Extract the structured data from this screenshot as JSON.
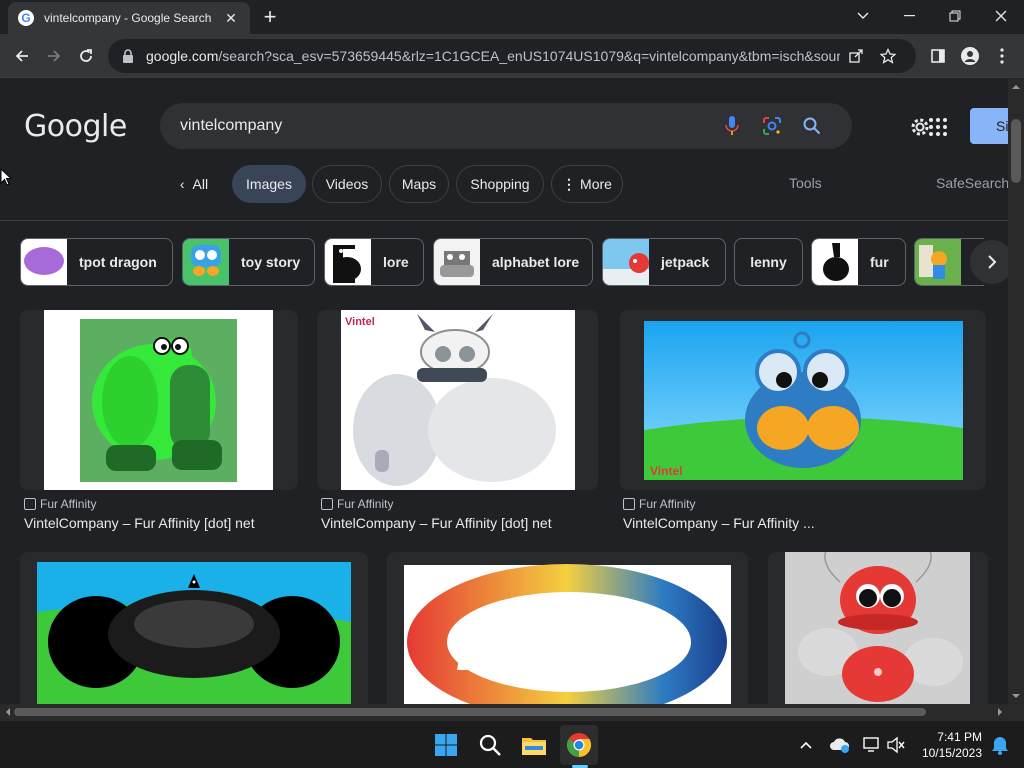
{
  "browser": {
    "tab_title": "vintelcompany - Google Search",
    "url_domain": "google.com",
    "url_path": "/search?sca_esv=573659445&rlz=1C1GCEA_enUS1074US1079&q=vintelcompany&tbm=isch&sourc..."
  },
  "google": {
    "logo_text": "Google",
    "search_value": "vintelcompany",
    "sign_in_label": "Si"
  },
  "filters": {
    "back_all": "All",
    "images": "Images",
    "videos": "Videos",
    "maps": "Maps",
    "shopping": "Shopping",
    "more": "More",
    "tools": "Tools",
    "safesearch": "SafeSearch"
  },
  "related": [
    {
      "label": "tpot dragon",
      "color": "#a66bd9"
    },
    {
      "label": "toy story",
      "color": "#3aa0e8"
    },
    {
      "label": "lore",
      "color": "#ffffff"
    },
    {
      "label": "alphabet lore",
      "color": "#eeeeee"
    },
    {
      "label": "jetpack",
      "color": "#7ec8f0"
    },
    {
      "label": "lenny",
      "color": ""
    },
    {
      "label": "fur",
      "color": "#ffffff"
    },
    {
      "label": "",
      "color": "#6ab04c"
    }
  ],
  "results": [
    {
      "source": "Fur Affinity",
      "title": "VintelCompany – Fur Affinity [dot] net"
    },
    {
      "source": "Fur Affinity",
      "title": "VintelCompany – Fur Affinity [dot] net"
    },
    {
      "source": "Fur Affinity",
      "title": "VintelCompany – Fur Affinity ..."
    }
  ],
  "image_texts": {
    "vintel_watermark": "Vintel",
    "vintel_watermark2": "Vintel"
  },
  "taskbar": {
    "time": "7:41 PM",
    "date": "10/15/2023"
  }
}
